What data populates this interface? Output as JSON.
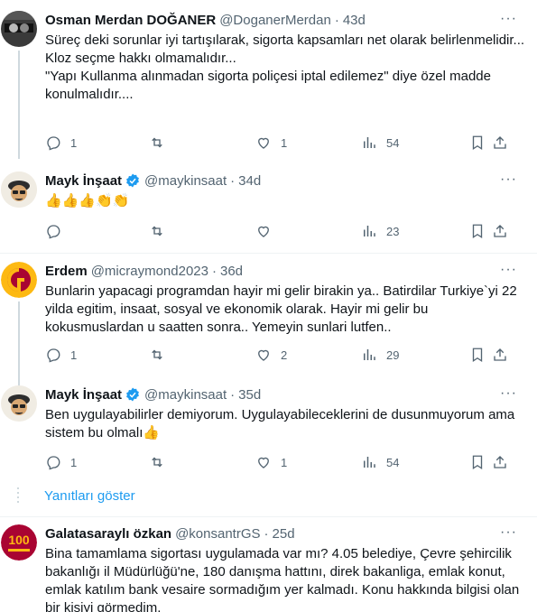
{
  "tweets": [
    {
      "name": "Osman Merdan DOĞANER",
      "handle": "@DoganerMerdan",
      "time": "43d",
      "text": "Süreç deki sorunlar iyi tartışılarak, sigorta kapsamları net olarak belirlenmelidir...\nKloz seçme hakkı olmamalıdır...\n\"Yapı Kullanma alınmadan sigorta poliçesi iptal edilemez\" diye özel madde konulmalıdır....",
      "replies": "1",
      "retweets": "",
      "likes": "1",
      "views": "54"
    },
    {
      "name": "Mayk İnşaat",
      "handle": "@maykinsaat",
      "time": "34d",
      "text": "👍👍👍👏👏",
      "replies": "",
      "retweets": "",
      "likes": "",
      "views": "23"
    },
    {
      "name": "Erdem",
      "handle": "@micraymond2023",
      "time": "36d",
      "text": "Bunlarin yapacagi programdan hayir mi gelir birakin ya.. Batirdilar Turkiye`yi 22 yilda egitim, insaat, sosyal ve ekonomik olarak. Hayir mi gelir bu kokusmuslardan u saatten sonra.. Yemeyin sunlari lutfen..",
      "replies": "1",
      "retweets": "",
      "likes": "2",
      "views": "29"
    },
    {
      "name": "Mayk İnşaat",
      "handle": "@maykinsaat",
      "time": "35d",
      "text": "Ben uygulayabilirler demiyorum. Uygulayabileceklerini de dusunmuyorum ama sistem bu olmalı👍",
      "replies": "1",
      "retweets": "",
      "likes": "1",
      "views": "54"
    },
    {
      "name": "Galatasaraylı özkan",
      "handle": "@konsantrGS",
      "time": "25d",
      "text": "Bina tamamlama sigortası uygulamada var mı? 4.05 belediye, Çevre şehircilik bakanlığı il Müdürlüğü'ne, 180 danışma hattını, direk bakanliga, emlak konut, emlak katılım bank vesaire sormadığım yer kalmadı. Konu hakkında bilgisi olan bir kişiyi görmedim.",
      "replies": "",
      "retweets": "",
      "likes": "",
      "views": ""
    }
  ],
  "show_replies_label": "Yanıtları göster",
  "more_label": "···",
  "colors": {
    "accent": "#1d9bf0",
    "muted": "#536471",
    "text": "#0f1419",
    "verified": "#1d9bf0"
  },
  "icons": [
    "reply-icon",
    "retweet-icon",
    "like-icon",
    "views-icon",
    "bookmark-icon",
    "share-icon",
    "verified-icon",
    "more-icon"
  ]
}
